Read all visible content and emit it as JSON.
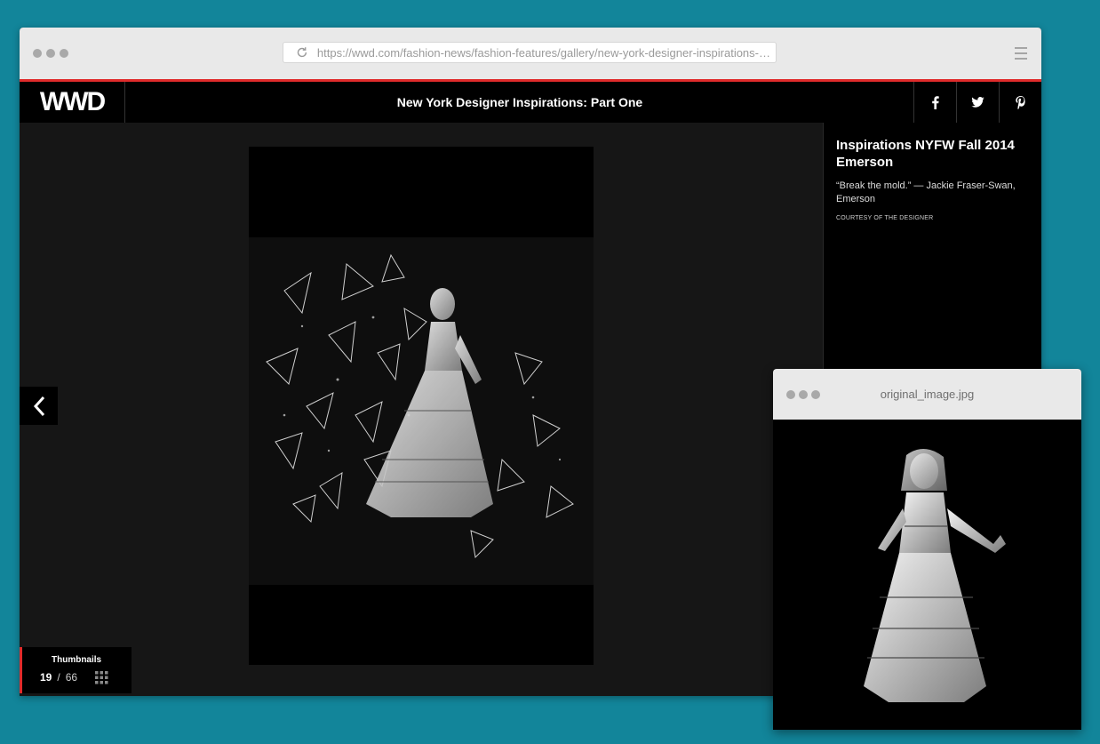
{
  "browser": {
    "url": "https://wwd.com/fashion-news/fashion-features/gallery/new-york-designer-inspirations-par...",
    "icons": [
      "reload-icon",
      "hamburger-menu-icon"
    ]
  },
  "header": {
    "logo": "WWD",
    "title": "New York Designer Inspirations: Part One",
    "social": [
      "facebook-icon",
      "twitter-icon",
      "pinterest-icon"
    ]
  },
  "gallery": {
    "thumbnails_label": "Thumbnails",
    "current": "19",
    "separator": "/",
    "total": "66"
  },
  "caption": {
    "title": "Inspirations NYFW Fall 2014 Emerson",
    "quote": "“Break the mold.” — Jackie Fraser-Swan, Emerson",
    "credit": "COURTESY OF THE DESIGNER"
  },
  "popup": {
    "title": "original_image.jpg"
  },
  "colors": {
    "background": "#12859a",
    "accent": "#e02b2b"
  }
}
